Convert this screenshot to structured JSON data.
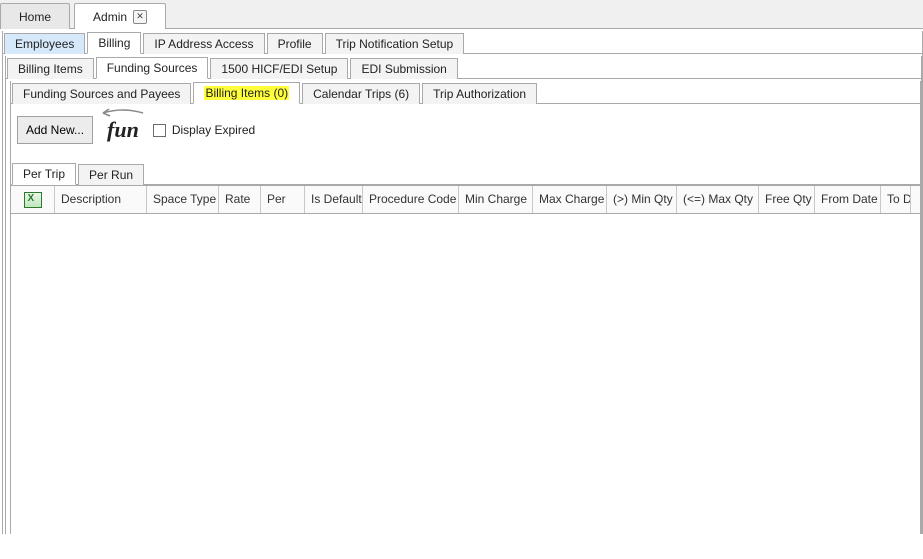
{
  "window_tabs": {
    "home": "Home",
    "admin": "Admin"
  },
  "main_tabs": {
    "employees": "Employees",
    "billing": "Billing",
    "ip_access": "IP Address Access",
    "profile": "Profile",
    "trip_notif": "Trip Notification Setup"
  },
  "billing_tabs": {
    "billing_items": "Billing Items",
    "funding_sources": "Funding Sources",
    "hicf": "1500 HICF/EDI Setup",
    "edi": "EDI Submission"
  },
  "funding_tabs": {
    "sources_payees": "Funding Sources and Payees",
    "billing_items_count": "Billing Items (0)",
    "calendar_trips": "Calendar Trips (6)",
    "trip_auth": "Trip Authorization"
  },
  "toolbar": {
    "add_new": "Add New...",
    "fun": "fun",
    "display_expired": "Display Expired"
  },
  "per_tabs": {
    "per_trip": "Per Trip",
    "per_run": "Per Run"
  },
  "grid_headers": {
    "description": "Description",
    "space_type": "Space Type",
    "rate": "Rate",
    "per": "Per",
    "is_default": "Is Default",
    "procedure_code": "Procedure Code",
    "min_charge": "Min Charge",
    "max_charge": "Max Charge",
    "min_qty": "(>) Min Qty",
    "max_qty": "(<=) Max Qty",
    "free_qty": "Free Qty",
    "from_date": "From Date",
    "to_date": "To D"
  }
}
